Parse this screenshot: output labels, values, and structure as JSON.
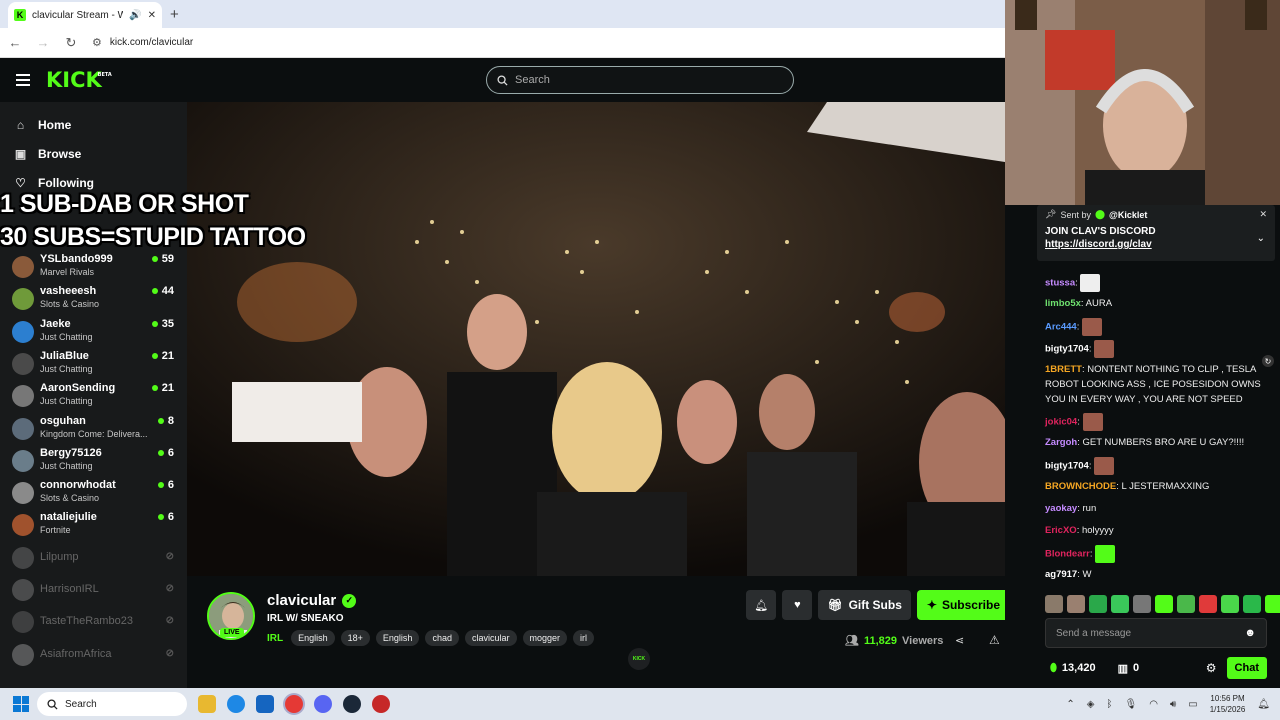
{
  "browser": {
    "tab_title": "clavicular Stream - Watch L",
    "new_tab": "+",
    "url": "kick.com/clavicular"
  },
  "header": {
    "logo": "KICK",
    "logo_badge": "BETA",
    "search_placeholder": "Search"
  },
  "sidebar": {
    "nav": [
      {
        "label": "Home",
        "icon": "home-icon"
      },
      {
        "label": "Browse",
        "icon": "browse-icon"
      },
      {
        "label": "Following",
        "icon": "heart-icon"
      }
    ],
    "channels": [
      {
        "name": "YSLbando999",
        "category": "Marvel Rivals",
        "viewers": "59",
        "live": true,
        "color": "#8a5a3a"
      },
      {
        "name": "vasheeesh",
        "category": "Slots & Casino",
        "viewers": "44",
        "live": true,
        "color": "#6f9a3a"
      },
      {
        "name": "Jaeke",
        "category": "Just Chatting",
        "viewers": "35",
        "live": true,
        "color": "#2c7fd0"
      },
      {
        "name": "JuliaBlue",
        "category": "Just Chatting",
        "viewers": "21",
        "live": true,
        "color": "#4a4a4a"
      },
      {
        "name": "AaronSending",
        "category": "Just Chatting",
        "viewers": "21",
        "live": true,
        "color": "#777"
      },
      {
        "name": "osguhan",
        "category": "Kingdom Come: Delivera...",
        "viewers": "8",
        "live": true,
        "color": "#5c6b7a"
      },
      {
        "name": "Bergy75126",
        "category": "Just Chatting",
        "viewers": "6",
        "live": true,
        "color": "#6a7d8a"
      },
      {
        "name": "connorwhodat",
        "category": "Slots & Casino",
        "viewers": "6",
        "live": true,
        "color": "#8a8a8a"
      },
      {
        "name": "nataliejulie",
        "category": "Fortnite",
        "viewers": "6",
        "live": true,
        "color": "#a0522d"
      },
      {
        "name": "Lilpump",
        "category": "",
        "viewers": "",
        "live": false,
        "color": "#999"
      },
      {
        "name": "HarrisonIRL",
        "category": "",
        "viewers": "",
        "live": false,
        "color": "#aaa"
      },
      {
        "name": "TasteTheRambo23",
        "category": "",
        "viewers": "",
        "live": false,
        "color": "#888"
      },
      {
        "name": "AsiafromAfrica",
        "category": "",
        "viewers": "",
        "live": false,
        "color": "#ccc"
      }
    ]
  },
  "overlay": {
    "line1": "1 SUB-DAB OR SHOT",
    "line2": "30 SUBS=STUPID TATTOO"
  },
  "channel": {
    "name": "clavicular",
    "live_label": "LIVE",
    "title": "IRL W/ SNEAKO",
    "category": "IRL",
    "tags": [
      "English",
      "18+",
      "English",
      "chad",
      "clavicular",
      "mogger",
      "irl"
    ],
    "gift_label": "Gift Subs",
    "subscribe_label": "Subscribe",
    "viewers": "11,829",
    "viewers_label": "Viewers"
  },
  "chat": {
    "pinned": {
      "sent_by": "Sent by",
      "user": "@Kicklet",
      "title": "JOIN CLAV'S DISCORD",
      "link": "https://discord.gg/clav"
    },
    "messages": [
      {
        "user": "stussa",
        "color": "#c58bff",
        "text": "",
        "emote": "#eeeeee"
      },
      {
        "user": "limbo5x",
        "color": "#6fe26f",
        "text": "AURA",
        "emote": ""
      },
      {
        "user": "Arc444",
        "color": "#5a9bff",
        "text": "",
        "emote": "#9a5a4a"
      },
      {
        "user": "bigty1704",
        "color": "#ffffff",
        "text": "",
        "emote": "#9a5a4a"
      },
      {
        "user": "1BRETT",
        "color": "#f5a623",
        "text": "NONTENT NOTHING TO CLIP , TESLA ROBOT LOOKING ASS , ICE POSESIDON OWNS YOU IN EVERY WAY , YOU ARE NOT SPEED",
        "emote": ""
      },
      {
        "user": "jokic04",
        "color": "#e0245e",
        "text": "",
        "emote": "#9a5a4a"
      },
      {
        "user": "Zargoh",
        "color": "#c58bff",
        "text": "GET NUMBERS BRO ARE U GAY?!!!!",
        "emote": ""
      },
      {
        "user": "bigty1704",
        "color": "#ffffff",
        "text": "",
        "emote": "#9a5a4a"
      },
      {
        "user": "BROWNCHODE",
        "color": "#f5a623",
        "text": "L JESTERMAXXING",
        "emote": ""
      },
      {
        "user": "yaokay",
        "color": "#c58bff",
        "text": "run",
        "emote": ""
      },
      {
        "user": "EricXO",
        "color": "#e0245e",
        "text": "holyyyy",
        "emote": ""
      },
      {
        "user": "Blondearr",
        "color": "#e0245e",
        "text": "",
        "emote": "#53fc18"
      },
      {
        "user": "ag7917",
        "color": "#ffffff",
        "text": "W",
        "emote": ""
      }
    ],
    "input_placeholder": "Send a message",
    "kicks": "13,420",
    "store_count": "0",
    "chat_button": "Chat"
  },
  "taskbar": {
    "search_label": "Search",
    "time": "10:56 PM",
    "date": "1/15/2026"
  }
}
